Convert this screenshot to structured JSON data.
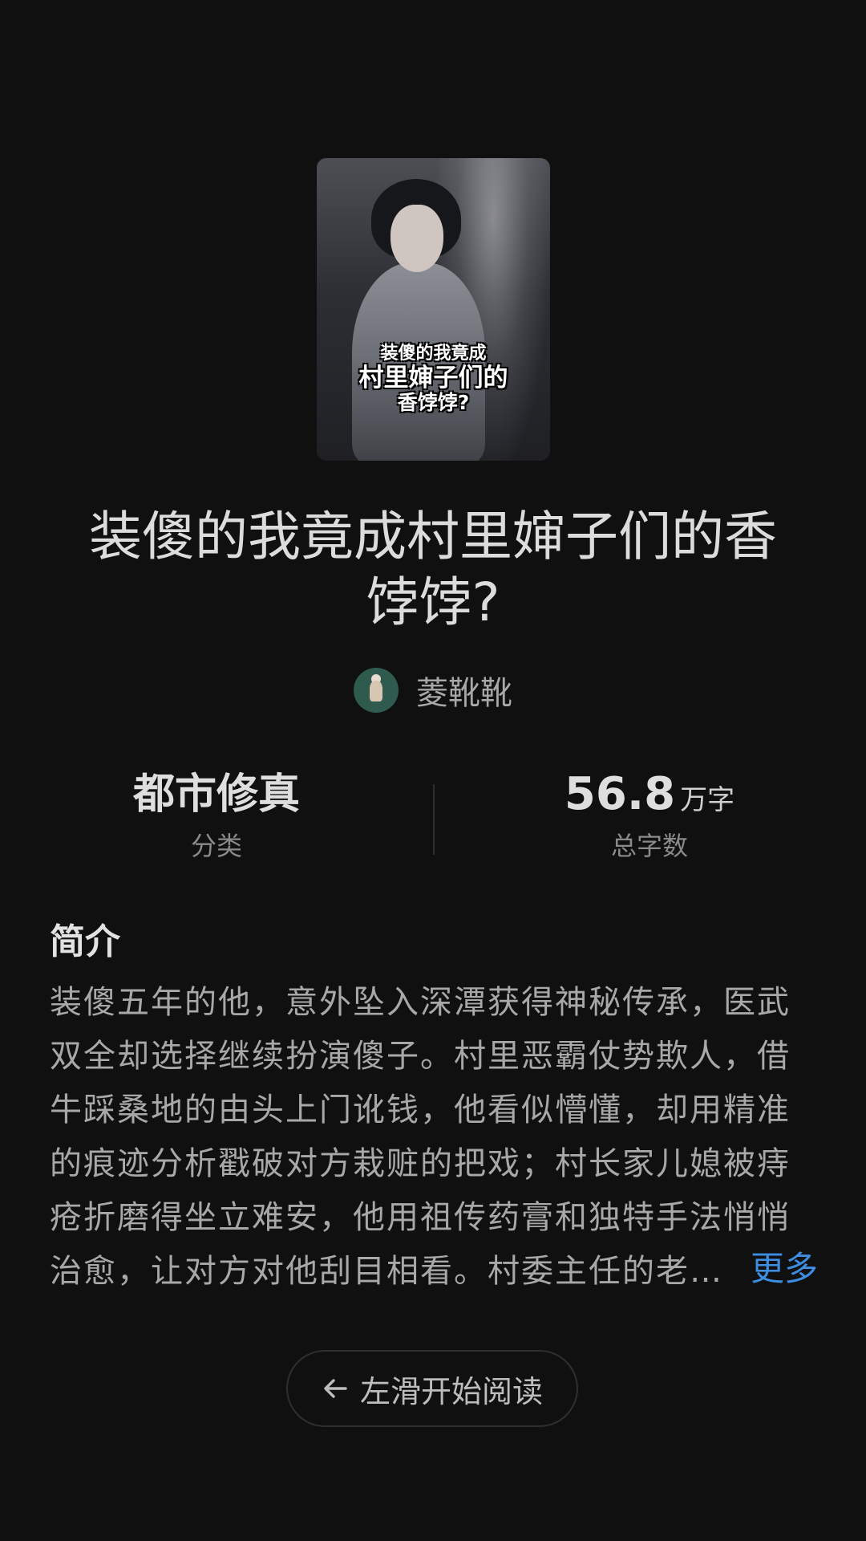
{
  "book": {
    "cover_text_line1": "装傻的我竟成",
    "cover_text_line2": "村里婶子们的",
    "cover_text_line3": "香饽饽?",
    "title": "装傻的我竟成村里婶子们的香饽饽?",
    "author": "菱靴靴"
  },
  "stats": {
    "category_value": "都市修真",
    "category_label": "分类",
    "word_count_value": "56.8",
    "word_count_unit": "万字",
    "word_count_label": "总字数"
  },
  "intro": {
    "heading": "简介",
    "text": "装傻五年的他，意外坠入深潭获得神秘传承，医武双全却选择继续扮演傻子。村里恶霸仗势欺人，借牛踩桑地的由头上门讹钱，他看似懵懂，却用精准的痕迹分析戳破对方栽赃的把戏；村长家儿媳被痔疮折磨得坐立难安，他用祖传药膏和独特手法悄悄治愈，让对方对他刮目相看。村委主任的老…",
    "more_label": "更多"
  },
  "read_button": {
    "label": "左滑开始阅读",
    "icon": "arrow-left-icon"
  },
  "colors": {
    "background": "#101010",
    "accent_link": "#3d8de0"
  }
}
